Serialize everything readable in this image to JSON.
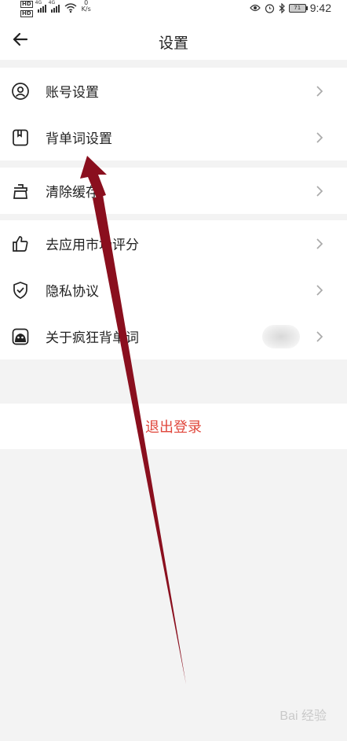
{
  "status_bar": {
    "hd1": "HD",
    "hd2": "HD",
    "sig1_label": "4G",
    "sig2_label": "4G",
    "net_speed_value": "0",
    "net_speed_unit": "K/s",
    "battery": "71",
    "time": "9:42"
  },
  "header": {
    "title": "设置",
    "back_icon": "arrow-left-icon"
  },
  "groups": [
    {
      "items": [
        {
          "label": "账号设置",
          "icon": "user-circle-icon"
        },
        {
          "label": "背单词设置",
          "icon": "notebook-icon"
        }
      ]
    },
    {
      "items": [
        {
          "label": "清除缓存",
          "icon": "broom-icon"
        }
      ]
    },
    {
      "items": [
        {
          "label": "去应用市场评分",
          "icon": "thumbs-up-icon"
        },
        {
          "label": "隐私协议",
          "icon": "shield-check-icon"
        },
        {
          "label": "关于疯狂背单词",
          "icon": "app-logo-icon"
        }
      ]
    }
  ],
  "logout_label": "退出登录",
  "watermark": "Bai 经验"
}
